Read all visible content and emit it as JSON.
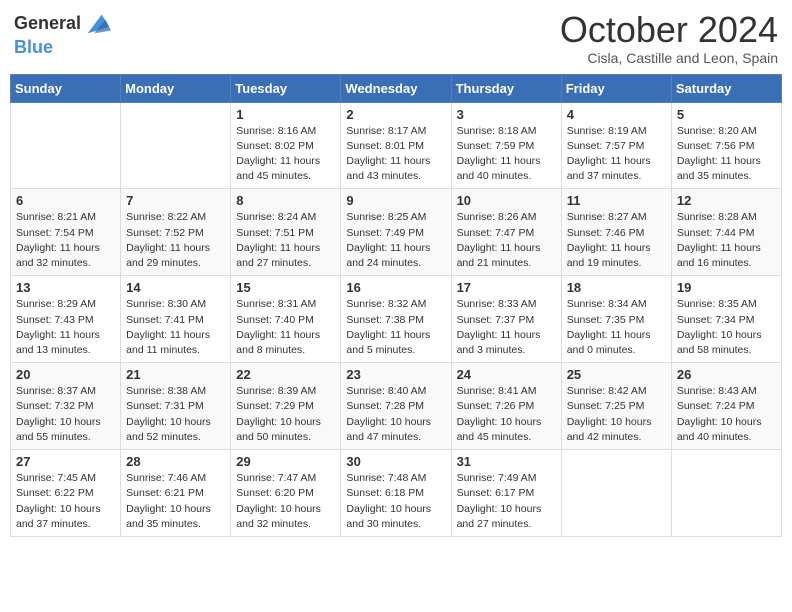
{
  "header": {
    "logo_line1": "General",
    "logo_line2": "Blue",
    "month": "October 2024",
    "location": "Cisla, Castille and Leon, Spain"
  },
  "weekdays": [
    "Sunday",
    "Monday",
    "Tuesday",
    "Wednesday",
    "Thursday",
    "Friday",
    "Saturday"
  ],
  "weeks": [
    [
      {
        "day": "",
        "info": ""
      },
      {
        "day": "",
        "info": ""
      },
      {
        "day": "1",
        "info": "Sunrise: 8:16 AM\nSunset: 8:02 PM\nDaylight: 11 hours and 45 minutes."
      },
      {
        "day": "2",
        "info": "Sunrise: 8:17 AM\nSunset: 8:01 PM\nDaylight: 11 hours and 43 minutes."
      },
      {
        "day": "3",
        "info": "Sunrise: 8:18 AM\nSunset: 7:59 PM\nDaylight: 11 hours and 40 minutes."
      },
      {
        "day": "4",
        "info": "Sunrise: 8:19 AM\nSunset: 7:57 PM\nDaylight: 11 hours and 37 minutes."
      },
      {
        "day": "5",
        "info": "Sunrise: 8:20 AM\nSunset: 7:56 PM\nDaylight: 11 hours and 35 minutes."
      }
    ],
    [
      {
        "day": "6",
        "info": "Sunrise: 8:21 AM\nSunset: 7:54 PM\nDaylight: 11 hours and 32 minutes."
      },
      {
        "day": "7",
        "info": "Sunrise: 8:22 AM\nSunset: 7:52 PM\nDaylight: 11 hours and 29 minutes."
      },
      {
        "day": "8",
        "info": "Sunrise: 8:24 AM\nSunset: 7:51 PM\nDaylight: 11 hours and 27 minutes."
      },
      {
        "day": "9",
        "info": "Sunrise: 8:25 AM\nSunset: 7:49 PM\nDaylight: 11 hours and 24 minutes."
      },
      {
        "day": "10",
        "info": "Sunrise: 8:26 AM\nSunset: 7:47 PM\nDaylight: 11 hours and 21 minutes."
      },
      {
        "day": "11",
        "info": "Sunrise: 8:27 AM\nSunset: 7:46 PM\nDaylight: 11 hours and 19 minutes."
      },
      {
        "day": "12",
        "info": "Sunrise: 8:28 AM\nSunset: 7:44 PM\nDaylight: 11 hours and 16 minutes."
      }
    ],
    [
      {
        "day": "13",
        "info": "Sunrise: 8:29 AM\nSunset: 7:43 PM\nDaylight: 11 hours and 13 minutes."
      },
      {
        "day": "14",
        "info": "Sunrise: 8:30 AM\nSunset: 7:41 PM\nDaylight: 11 hours and 11 minutes."
      },
      {
        "day": "15",
        "info": "Sunrise: 8:31 AM\nSunset: 7:40 PM\nDaylight: 11 hours and 8 minutes."
      },
      {
        "day": "16",
        "info": "Sunrise: 8:32 AM\nSunset: 7:38 PM\nDaylight: 11 hours and 5 minutes."
      },
      {
        "day": "17",
        "info": "Sunrise: 8:33 AM\nSunset: 7:37 PM\nDaylight: 11 hours and 3 minutes."
      },
      {
        "day": "18",
        "info": "Sunrise: 8:34 AM\nSunset: 7:35 PM\nDaylight: 11 hours and 0 minutes."
      },
      {
        "day": "19",
        "info": "Sunrise: 8:35 AM\nSunset: 7:34 PM\nDaylight: 10 hours and 58 minutes."
      }
    ],
    [
      {
        "day": "20",
        "info": "Sunrise: 8:37 AM\nSunset: 7:32 PM\nDaylight: 10 hours and 55 minutes."
      },
      {
        "day": "21",
        "info": "Sunrise: 8:38 AM\nSunset: 7:31 PM\nDaylight: 10 hours and 52 minutes."
      },
      {
        "day": "22",
        "info": "Sunrise: 8:39 AM\nSunset: 7:29 PM\nDaylight: 10 hours and 50 minutes."
      },
      {
        "day": "23",
        "info": "Sunrise: 8:40 AM\nSunset: 7:28 PM\nDaylight: 10 hours and 47 minutes."
      },
      {
        "day": "24",
        "info": "Sunrise: 8:41 AM\nSunset: 7:26 PM\nDaylight: 10 hours and 45 minutes."
      },
      {
        "day": "25",
        "info": "Sunrise: 8:42 AM\nSunset: 7:25 PM\nDaylight: 10 hours and 42 minutes."
      },
      {
        "day": "26",
        "info": "Sunrise: 8:43 AM\nSunset: 7:24 PM\nDaylight: 10 hours and 40 minutes."
      }
    ],
    [
      {
        "day": "27",
        "info": "Sunrise: 7:45 AM\nSunset: 6:22 PM\nDaylight: 10 hours and 37 minutes."
      },
      {
        "day": "28",
        "info": "Sunrise: 7:46 AM\nSunset: 6:21 PM\nDaylight: 10 hours and 35 minutes."
      },
      {
        "day": "29",
        "info": "Sunrise: 7:47 AM\nSunset: 6:20 PM\nDaylight: 10 hours and 32 minutes."
      },
      {
        "day": "30",
        "info": "Sunrise: 7:48 AM\nSunset: 6:18 PM\nDaylight: 10 hours and 30 minutes."
      },
      {
        "day": "31",
        "info": "Sunrise: 7:49 AM\nSunset: 6:17 PM\nDaylight: 10 hours and 27 minutes."
      },
      {
        "day": "",
        "info": ""
      },
      {
        "day": "",
        "info": ""
      }
    ]
  ]
}
